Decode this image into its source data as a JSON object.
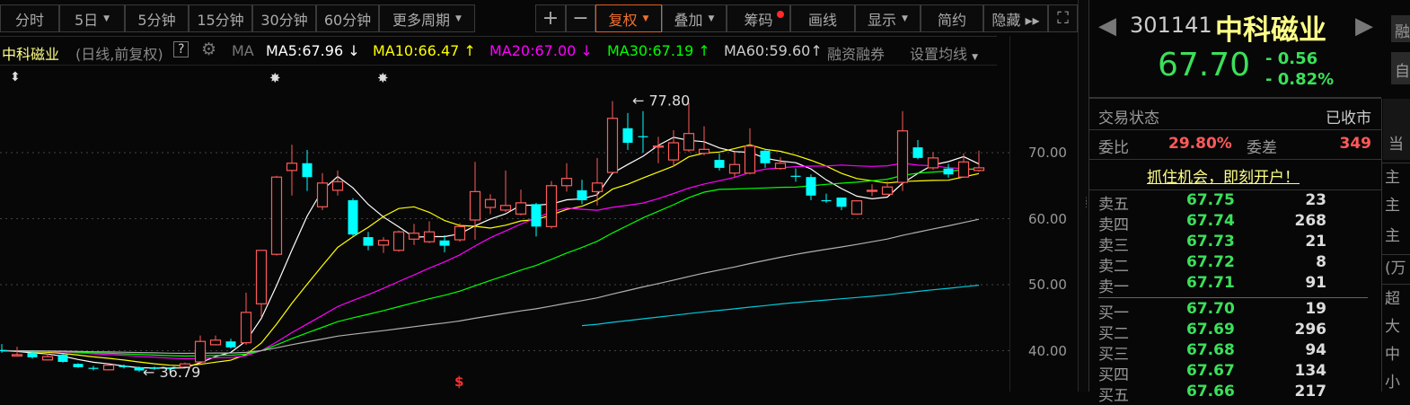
{
  "toolbar": {
    "periods": [
      {
        "label": "分时"
      },
      {
        "label": "5日",
        "caret": true
      },
      {
        "label": "5分钟"
      },
      {
        "label": "15分钟"
      },
      {
        "label": "30分钟"
      },
      {
        "label": "60分钟"
      },
      {
        "label": "更多周期",
        "caret": true
      }
    ],
    "zoom_in": "+",
    "zoom_out": "−",
    "tools": [
      {
        "label": "复权",
        "caret": true,
        "active": true
      },
      {
        "label": "叠加",
        "caret": true
      },
      {
        "label": "筹码",
        "dot": true
      },
      {
        "label": "画线"
      },
      {
        "label": "显示",
        "caret": true
      },
      {
        "label": "简约"
      },
      {
        "label": "隐藏 ▸▸"
      }
    ]
  },
  "legend": {
    "name": "中科磁业",
    "mode": "(日线,前复权)",
    "help": "?",
    "ma": "MA",
    "ma5": "MA5:67.96",
    "ma5_arrow": "↓",
    "ma10": "MA10:66.47",
    "ma10_arrow": "↑",
    "ma20": "MA20:67.00",
    "ma20_arrow": "↓",
    "ma30": "MA30:67.19",
    "ma30_arrow": "↑",
    "ma60": "MA60:59.60",
    "ma60_arrow": "↑",
    "margin": "融资融券",
    "set_ma": "设置均线"
  },
  "colors": {
    "up": "#ff5a5a",
    "down": "#00ffff",
    "ma5": "#ffffff",
    "ma10": "#ffff00",
    "ma20": "#ff00ff",
    "ma30": "#00ff00",
    "ma60": "#b0b0b0",
    "ma120": "#00c8d8",
    "accent": "#e06020"
  },
  "chart_data": {
    "type": "candlestick",
    "ylim": [
      35.5,
      80
    ],
    "yticks": [
      "70.00",
      "60.00",
      "50.00",
      "40.00"
    ],
    "ytick_values": [
      70,
      60,
      50,
      40
    ],
    "max_label": "77.80",
    "min_label": "36.79",
    "candles": [
      [
        40.1,
        41.0,
        39.7,
        40.0
      ],
      [
        39.2,
        40.6,
        39.1,
        39.4
      ],
      [
        39.7,
        40.0,
        38.8,
        39.0
      ],
      [
        38.6,
        39.6,
        38.5,
        39.1
      ],
      [
        39.4,
        39.5,
        38.2,
        38.3
      ],
      [
        38.0,
        38.1,
        37.4,
        37.5
      ],
      [
        37.4,
        37.7,
        37.0,
        37.3
      ],
      [
        37.1,
        37.9,
        37.0,
        37.8
      ],
      [
        37.7,
        37.9,
        37.3,
        37.5
      ],
      [
        37.5,
        37.6,
        36.79,
        37.0
      ],
      [
        37.4,
        37.6,
        37.1,
        37.3
      ],
      [
        37.4,
        37.5,
        37.0,
        37.2
      ],
      [
        37.5,
        38.2,
        37.4,
        38.0
      ],
      [
        38.3,
        42.3,
        38.0,
        41.4
      ],
      [
        40.9,
        42.3,
        40.8,
        41.6
      ],
      [
        41.4,
        41.8,
        40.3,
        40.5
      ],
      [
        41.2,
        48.8,
        40.9,
        45.8
      ],
      [
        47.1,
        55.2,
        45.1,
        55.2
      ],
      [
        54.6,
        66.5,
        54.4,
        66.3
      ],
      [
        67.3,
        71.2,
        63.5,
        68.4
      ],
      [
        68.4,
        70.4,
        64.2,
        66.3
      ],
      [
        61.8,
        66.9,
        61.3,
        65.4
      ],
      [
        64.3,
        67.3,
        63.5,
        65.6
      ],
      [
        62.8,
        63.1,
        57.4,
        57.6
      ],
      [
        57.2,
        58.0,
        55.2,
        55.9
      ],
      [
        56.0,
        57.2,
        54.8,
        56.7
      ],
      [
        55.2,
        58.2,
        55.0,
        58.0
      ],
      [
        56.9,
        59.2,
        56.0,
        57.8
      ],
      [
        56.5,
        59.6,
        56.3,
        58.0
      ],
      [
        56.7,
        57.5,
        54.9,
        55.9
      ],
      [
        56.8,
        59.3,
        56.5,
        58.8
      ],
      [
        59.8,
        68.6,
        56.8,
        64.1
      ],
      [
        61.7,
        63.7,
        60.7,
        62.9
      ],
      [
        61.3,
        67.3,
        61.0,
        62.0
      ],
      [
        60.7,
        64.4,
        60.5,
        62.4
      ],
      [
        62.2,
        62.4,
        57.3,
        58.8
      ],
      [
        58.8,
        65.7,
        58.5,
        65.0
      ],
      [
        65.0,
        68.4,
        64.1,
        66.1
      ],
      [
        64.3,
        65.9,
        62.2,
        62.8
      ],
      [
        64.1,
        69.2,
        62.0,
        65.4
      ],
      [
        67.0,
        77.8,
        66.9,
        75.2
      ],
      [
        73.7,
        76.0,
        70.4,
        71.5
      ],
      [
        72.5,
        76.3,
        70.0,
        72.4
      ],
      [
        70.9,
        72.4,
        68.4,
        71.0
      ],
      [
        68.9,
        73.4,
        67.9,
        71.5
      ],
      [
        70.4,
        77.6,
        70.1,
        72.9
      ],
      [
        69.9,
        74.0,
        69.6,
        70.5
      ],
      [
        68.9,
        69.9,
        67.3,
        67.7
      ],
      [
        66.9,
        70.1,
        66.3,
        68.2
      ],
      [
        66.9,
        73.7,
        66.7,
        71.0
      ],
      [
        70.3,
        70.6,
        67.7,
        68.4
      ],
      [
        67.6,
        69.3,
        67.4,
        68.4
      ],
      [
        66.5,
        67.6,
        65.6,
        66.4
      ],
      [
        66.3,
        66.7,
        62.8,
        63.5
      ],
      [
        62.8,
        63.8,
        62.4,
        62.7
      ],
      [
        63.2,
        63.2,
        61.3,
        61.8
      ],
      [
        60.7,
        62.8,
        60.7,
        62.7
      ],
      [
        64.2,
        65.2,
        63.4,
        64.3
      ],
      [
        63.7,
        65.7,
        63.6,
        64.8
      ],
      [
        65.5,
        76.3,
        64.2,
        73.3
      ],
      [
        70.8,
        71.9,
        69.0,
        69.2
      ],
      [
        67.7,
        70.1,
        67.4,
        69.2
      ],
      [
        67.6,
        68.3,
        66.2,
        66.7
      ],
      [
        66.3,
        69.9,
        66.2,
        68.6
      ],
      [
        67.3,
        70.3,
        67.1,
        67.7
      ]
    ],
    "ma_periods": [
      5,
      10,
      20,
      30,
      60,
      120
    ]
  },
  "markers": {
    "top1": "⬍",
    "top2": "✸",
    "top3": "✸",
    "bottom": "$"
  },
  "quote": {
    "code": "301141",
    "name": "中科磁业",
    "price": "67.70",
    "change": "- 0.56",
    "change_pct": "- 0.82%",
    "status_label": "交易状态",
    "status": "已收市",
    "ratio_label": "委比",
    "ratio": "29.80%",
    "diff_label": "委差",
    "diff": "349",
    "promo": "抓住机会，即刻开户！",
    "asks": [
      {
        "name": "卖五",
        "price": "67.75",
        "vol": "23"
      },
      {
        "name": "卖四",
        "price": "67.74",
        "vol": "268"
      },
      {
        "name": "卖三",
        "price": "67.73",
        "vol": "21"
      },
      {
        "name": "卖二",
        "price": "67.72",
        "vol": "8"
      },
      {
        "name": "卖一",
        "price": "67.71",
        "vol": "91"
      }
    ],
    "bids": [
      {
        "name": "买一",
        "price": "67.70",
        "vol": "19"
      },
      {
        "name": "买二",
        "price": "67.69",
        "vol": "296"
      },
      {
        "name": "买三",
        "price": "67.68",
        "vol": "94"
      },
      {
        "name": "买四",
        "price": "67.67",
        "vol": "134"
      },
      {
        "name": "买五",
        "price": "67.66",
        "vol": "217"
      }
    ]
  },
  "side": {
    "btn1": "融",
    "btn2": "自",
    "tab": "当",
    "rows": [
      "主",
      "主",
      "主",
      "(万",
      "超",
      "大",
      "中",
      "小"
    ]
  }
}
